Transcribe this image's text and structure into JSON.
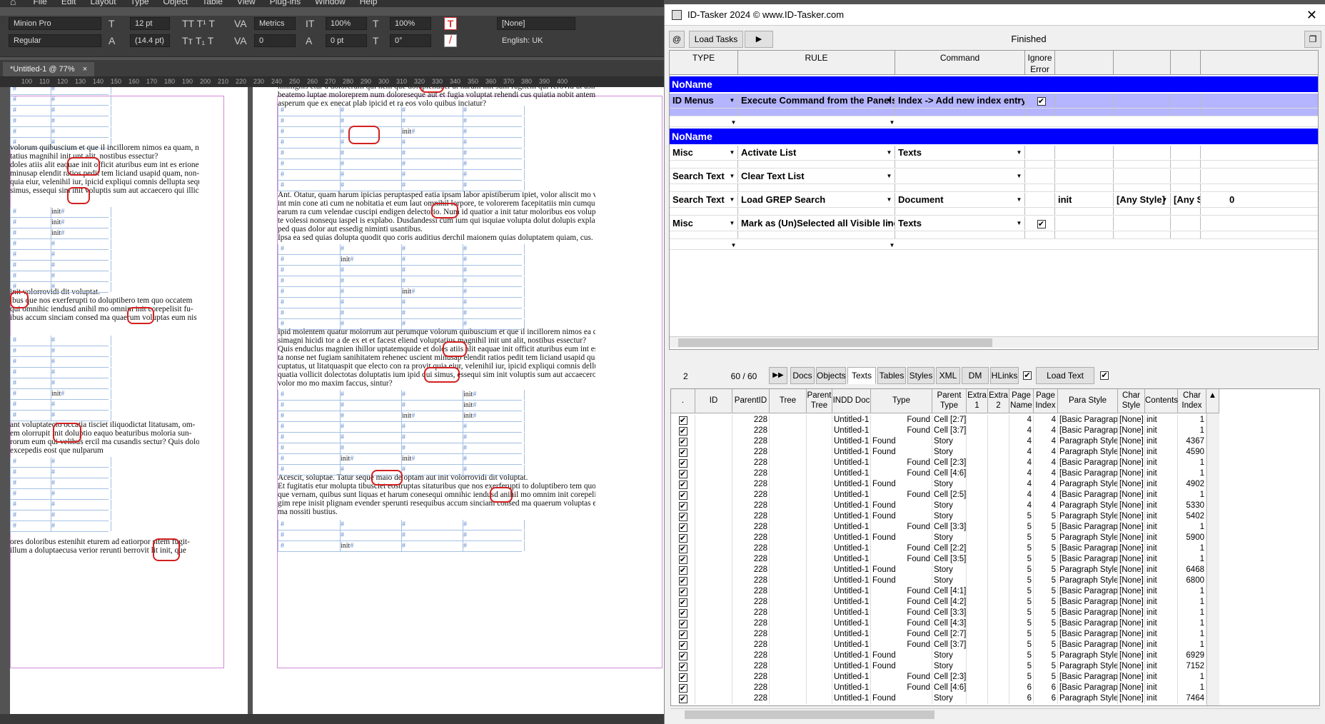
{
  "indesign": {
    "menus": [
      "File",
      "Edit",
      "Layout",
      "Type",
      "Object",
      "Table",
      "View",
      "Plug-ins",
      "Window",
      "Help"
    ],
    "control": {
      "font_family": "Minion Pro",
      "font_style": "Regular",
      "font_size": "12 pt",
      "leading": "(14.4 pt)",
      "kerning": "Metrics",
      "tracking": "0",
      "hscale": "100%",
      "vscale": "100%",
      "baseline": "0 pt",
      "skew": "0°",
      "char_style": "[None]",
      "language": "English: UK"
    },
    "doc_tab": "*Untitled-1 @ 77%",
    "doc_tab_close": "×",
    "ruler_ticks": [
      "100",
      "110",
      "120",
      "130",
      "140",
      "150",
      "160",
      "170",
      "180",
      "190",
      "200",
      "210",
      "220",
      "230",
      "240",
      "250",
      "260",
      "270",
      "280",
      "290",
      "300",
      "310",
      "320",
      "330",
      "340",
      "350",
      "360",
      "370",
      "380",
      "390",
      "400"
    ]
  },
  "page_left": {
    "paras": [
      "volorum quibuscium et que il incillorem nimos ea quam, nus",
      "tatius magnihil init unt alit, nostibus essectur?",
      "doles atiis alit eaquae init officit aturibus eum int es erionec-",
      "minusap elendit ratios pedit tem liciand usapid quam, non-",
      "quia eiur, velenihil iur, ipicid expliqui comnis dellupta sequis",
      "simus, essequi sim init voluptis sum aut accaecero qui illicae",
      "init volorrovidi dit voluptat.",
      "ibus que nos exerferupti to doluptibero tem quo occatem",
      "qui omnihic iendusd anihil mo omnim init corepelisit fu-",
      "ibus accum sinciam consed ma quaerum voluptas eum nis",
      "ant voluptatecto occatia tisciet iliquodictat litatusam, om-",
      "em olorrupit init doluptio eaquo beaturibus moloria sun-",
      "rorum eum qui velibus ercil ma cusandis sectur? Quis dolo",
      "excepedis eost que nulparum",
      "ores doloribus estenihit eturem ad eatiorpor sitem fugit-",
      "illum a doluptaecusa verior rerunti berrovit lit init, que"
    ],
    "cell_text": "init"
  },
  "page_right": {
    "paras": [
      "nihilignis etur a dolorerum qui nem que dolupienduci ut harum init sum fugitem qui rerovid ut asimusci",
      "beatemo luptae moloreprem num doloreseque aut et fugia voluptat rehendi cus quiatia nobit antem sam aut",
      "asperum que ex enecat plab ipicid et ra eos volo quibus inciatur?",
      "Ant. Otatur, quam harum ipicias peruptasped eatia ipsam labor apistiberum ipiet, volor aliscit mo volorest il",
      "int min cone ati cum ne nobitatia et eum laut omnihil lorpore, te volorerem facepitatiis min cumquam fugit",
      "earum ra cum velendae cuscipi endigen delectorio. Num id quatior a init tatur moloribus eos volupta simi,",
      "te volessi nonsequ iaspel is explabo. Dusdandessi cum ium qui isquiae volupta dolut dolupis explaut as et de",
      "ped quas dolor aut essedig niminti usantibus.",
      "Ipsa ea sed quias dolupta quodit quo coris auditius derchil maionem quias doluptatem quiam, cus.",
      "Ipid molentem quatur molorrum aut perumque volorum quibuscium et que il incillorem nimos ea quam, nus",
      "simagni hicidi tor a de ex et et facest eliend voluptatius magnihil init unt alit, nostibus essectur?",
      "Quis enduclus magnien ihillor uptatemquide et doles atiis alit eaquae init officit aturibus eum int es erionec-",
      "ta nonse net fugiam sanihitatem rehenec uscient minusap elendit ratios pedit tem liciand usapid quam, non-",
      "cuptatus, ut litatquaspit que electo con ra provit quia eiur, velenihil iur, ipicid expliqui comnis dellupta sequis",
      "quatia vollicit dolectotas doluptatis ium ipid qui simus, essequi sim init voluptis sum aut accaecero qui illicae",
      "volor mo mo maxim faccus, sintur?",
      "Acescit, soluptae. Tatur seque maio de optam aut init volorrovidi dit voluptat.",
      "Et fugitatis etur molupta tibusciet eostruptas sitaturibus que nos exerferupti to doluptibero tem quo occatem",
      "que vernam, quibus sunt liquas et harum conesequi omnihic iendusd anihil mo omnim init corepelisit fu-",
      "gim repe inisit plignam evender sperunti resequibus accum sinciam consed ma quaerum voluptas eum nis",
      "ma nossiti bustius."
    ],
    "cell_text": "init"
  },
  "idtasker": {
    "title": "ID-Tasker 2024  © www.ID-Tasker.com",
    "close": "✕",
    "at_button": "@",
    "load_tasks": "Load Tasks",
    "run_button": "▶",
    "status": "Finished",
    "restore_button": "❐",
    "rule_headers": [
      "TYPE",
      "RULE",
      "Command",
      "Ignore\nError",
      "",
      "",
      ""
    ],
    "groups": [
      {
        "name": "NoName",
        "rows": [
          {
            "type": "ID Menus",
            "rule": "Execute Command from the Panels",
            "command": "Index -> Add new index entry",
            "ignore": "✔",
            "p1": "",
            "p2": "",
            "p3": "",
            "p4": ""
          }
        ]
      },
      {
        "name": "NoName",
        "rows": [
          {
            "type": "Misc",
            "rule": "Activate List",
            "command": "Texts",
            "ignore": "",
            "p1": "",
            "p2": "",
            "p3": "",
            "p4": ""
          },
          {
            "type": "Search Text",
            "rule": "Clear Text List",
            "command": "",
            "ignore": "",
            "p1": "",
            "p2": "",
            "p3": "",
            "p4": ""
          },
          {
            "type": "Search Text",
            "rule": "Load GREP Search",
            "command": "Document",
            "ignore": "",
            "p1": "init",
            "p2": "[Any Style]",
            "p3": "[Any Style]",
            "p4": "0"
          },
          {
            "type": "Misc",
            "rule": "Mark as (Un)Selected all Visible lines",
            "command": "Texts",
            "ignore": "✔",
            "p1": "",
            "p2": "",
            "p3": "",
            "p4": ""
          }
        ]
      }
    ],
    "nav": {
      "count": "2",
      "position": "60 / 60",
      "fast_forward": "▶▶",
      "tabs": [
        "Docs",
        "Objects",
        "Texts",
        "Tables",
        "Styles",
        "XML",
        "DM",
        "HLinks"
      ],
      "selected_tab": "Texts",
      "load_text": "Load Text"
    },
    "table_headers": [
      ".",
      "ID",
      "ParentID",
      "Tree",
      "Parent\nTree",
      "INDD Doc",
      "Type",
      "Parent\nType",
      "Extra\n1",
      "Extra\n2",
      "Page\nName",
      "Page\nIndex",
      "Para Style",
      "Char\nStyle",
      "Contents",
      "Char\nIndex"
    ],
    "table_rows": [
      [
        "✔",
        "",
        "228",
        "",
        "",
        "Untitled-1",
        "Found",
        "Cell [2:7]",
        "",
        "",
        "4",
        "4",
        "[Basic Paragraph]",
        "[None]",
        "init",
        "1"
      ],
      [
        "✔",
        "",
        "228",
        "",
        "",
        "Untitled-1",
        "Found",
        "Cell [3:7]",
        "",
        "",
        "4",
        "4",
        "[Basic Paragraph]",
        "[None]",
        "init",
        "1"
      ],
      [
        "✔",
        "",
        "228",
        "",
        "",
        "Untitled-1",
        "Found",
        "Story",
        "",
        "",
        "4",
        "4",
        "Paragraph Style 1",
        "[None]",
        "init",
        "4367"
      ],
      [
        "✔",
        "",
        "228",
        "",
        "",
        "Untitled-1",
        "Found",
        "Story",
        "",
        "",
        "4",
        "4",
        "Paragraph Style 1",
        "[None]",
        "init",
        "4590"
      ],
      [
        "✔",
        "",
        "228",
        "",
        "",
        "Untitled-1",
        "Found",
        "Cell [2:3]",
        "",
        "",
        "4",
        "4",
        "[Basic Paragraph]",
        "[None]",
        "init",
        "1"
      ],
      [
        "✔",
        "",
        "228",
        "",
        "",
        "Untitled-1",
        "Found",
        "Cell [4:6]",
        "",
        "",
        "4",
        "4",
        "[Basic Paragraph]",
        "[None]",
        "init",
        "1"
      ],
      [
        "✔",
        "",
        "228",
        "",
        "",
        "Untitled-1",
        "Found",
        "Story",
        "",
        "",
        "4",
        "4",
        "Paragraph Style 1",
        "[None]",
        "init",
        "4902"
      ],
      [
        "✔",
        "",
        "228",
        "",
        "",
        "Untitled-1",
        "Found",
        "Cell [2:5]",
        "",
        "",
        "4",
        "4",
        "[Basic Paragraph]",
        "[None]",
        "init",
        "1"
      ],
      [
        "✔",
        "",
        "228",
        "",
        "",
        "Untitled-1",
        "Found",
        "Story",
        "",
        "",
        "4",
        "4",
        "Paragraph Style 1",
        "[None]",
        "init",
        "5330"
      ],
      [
        "✔",
        "",
        "228",
        "",
        "",
        "Untitled-1",
        "Found",
        "Story",
        "",
        "",
        "5",
        "5",
        "Paragraph Style 1",
        "[None]",
        "init",
        "5402"
      ],
      [
        "✔",
        "",
        "228",
        "",
        "",
        "Untitled-1",
        "Found",
        "Cell [3:3]",
        "",
        "",
        "5",
        "5",
        "[Basic Paragraph]",
        "[None]",
        "init",
        "1"
      ],
      [
        "✔",
        "",
        "228",
        "",
        "",
        "Untitled-1",
        "Found",
        "Story",
        "",
        "",
        "5",
        "5",
        "Paragraph Style 1",
        "[None]",
        "init",
        "5900"
      ],
      [
        "✔",
        "",
        "228",
        "",
        "",
        "Untitled-1",
        "Found",
        "Cell [2:2]",
        "",
        "",
        "5",
        "5",
        "[Basic Paragraph]",
        "[None]",
        "init",
        "1"
      ],
      [
        "✔",
        "",
        "228",
        "",
        "",
        "Untitled-1",
        "Found",
        "Cell [3:5]",
        "",
        "",
        "5",
        "5",
        "[Basic Paragraph]",
        "[None]",
        "init",
        "1"
      ],
      [
        "✔",
        "",
        "228",
        "",
        "",
        "Untitled-1",
        "Found",
        "Story",
        "",
        "",
        "5",
        "5",
        "Paragraph Style 1",
        "[None]",
        "init",
        "6468"
      ],
      [
        "✔",
        "",
        "228",
        "",
        "",
        "Untitled-1",
        "Found",
        "Story",
        "",
        "",
        "5",
        "5",
        "Paragraph Style 1",
        "[None]",
        "init",
        "6800"
      ],
      [
        "✔",
        "",
        "228",
        "",
        "",
        "Untitled-1",
        "Found",
        "Cell [4:1]",
        "",
        "",
        "5",
        "5",
        "[Basic Paragraph]",
        "[None]",
        "init",
        "1"
      ],
      [
        "✔",
        "",
        "228",
        "",
        "",
        "Untitled-1",
        "Found",
        "Cell [4:2]",
        "",
        "",
        "5",
        "5",
        "[Basic Paragraph]",
        "[None]",
        "init",
        "1"
      ],
      [
        "✔",
        "",
        "228",
        "",
        "",
        "Untitled-1",
        "Found",
        "Cell [3:3]",
        "",
        "",
        "5",
        "5",
        "[Basic Paragraph]",
        "[None]",
        "init",
        "1"
      ],
      [
        "✔",
        "",
        "228",
        "",
        "",
        "Untitled-1",
        "Found",
        "Cell [4:3]",
        "",
        "",
        "5",
        "5",
        "[Basic Paragraph]",
        "[None]",
        "init",
        "1"
      ],
      [
        "✔",
        "",
        "228",
        "",
        "",
        "Untitled-1",
        "Found",
        "Cell [2:7]",
        "",
        "",
        "5",
        "5",
        "[Basic Paragraph]",
        "[None]",
        "init",
        "1"
      ],
      [
        "✔",
        "",
        "228",
        "",
        "",
        "Untitled-1",
        "Found",
        "Cell [3:7]",
        "",
        "",
        "5",
        "5",
        "[Basic Paragraph]",
        "[None]",
        "init",
        "1"
      ],
      [
        "✔",
        "",
        "228",
        "",
        "",
        "Untitled-1",
        "Found",
        "Story",
        "",
        "",
        "5",
        "5",
        "Paragraph Style 1",
        "[None]",
        "init",
        "6929"
      ],
      [
        "✔",
        "",
        "228",
        "",
        "",
        "Untitled-1",
        "Found",
        "Story",
        "",
        "",
        "5",
        "5",
        "Paragraph Style 1",
        "[None]",
        "init",
        "7152"
      ],
      [
        "✔",
        "",
        "228",
        "",
        "",
        "Untitled-1",
        "Found",
        "Cell [2:3]",
        "",
        "",
        "5",
        "5",
        "[Basic Paragraph]",
        "[None]",
        "init",
        "1"
      ],
      [
        "✔",
        "",
        "228",
        "",
        "",
        "Untitled-1",
        "Found",
        "Cell [4:6]",
        "",
        "",
        "6",
        "6",
        "[Basic Paragraph]",
        "[None]",
        "init",
        "1"
      ],
      [
        "✔",
        "",
        "228",
        "",
        "",
        "Untitled-1",
        "Found",
        "Story",
        "",
        "",
        "6",
        "6",
        "Paragraph Style 1",
        "[None]",
        "init",
        "7464"
      ]
    ]
  },
  "colors": {
    "group_bar": "#0000ff",
    "highlight": "#d32020",
    "frame": "#d28ad6",
    "table_grid": "#a4c0e4"
  }
}
